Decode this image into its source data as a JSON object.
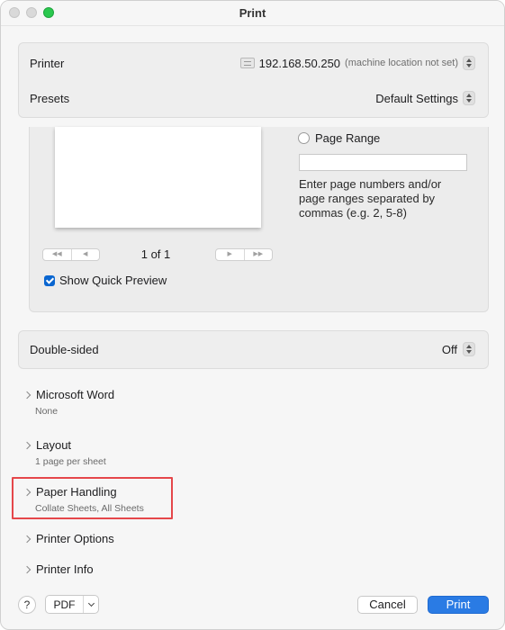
{
  "window": {
    "title": "Print"
  },
  "printer": {
    "label": "Printer",
    "icon": "printer-icon",
    "address": "192.168.50.250",
    "location": "(machine location not set)"
  },
  "presets": {
    "label": "Presets",
    "value": "Default Settings"
  },
  "preview": {
    "page_count": "1 of 1",
    "nav_first": "◀◀",
    "nav_prev": "◀",
    "nav_next": "▶",
    "nav_last": "▶▶",
    "show_quick_preview_label": "Show Quick Preview",
    "show_quick_preview_checked": true
  },
  "page_range": {
    "label": "Page Range",
    "input_value": "",
    "help": "Enter page numbers and/or page ranges separated by commas (e.g. 2, 5-8)"
  },
  "double_sided": {
    "label": "Double-sided",
    "value": "Off"
  },
  "sections": [
    {
      "title": "Microsoft Word",
      "subtitle": "None"
    },
    {
      "title": "Layout",
      "subtitle": "1 page per sheet"
    },
    {
      "title": "Paper Handling",
      "subtitle": "Collate Sheets, All Sheets"
    },
    {
      "title": "Printer Options",
      "subtitle": ""
    },
    {
      "title": "Printer Info",
      "subtitle": ""
    }
  ],
  "footer": {
    "help": "?",
    "pdf": "PDF",
    "cancel": "Cancel",
    "print": "Print"
  },
  "colors": {
    "accent": "#2a7be4",
    "highlight": "#e5474a",
    "checkbox": "#0a66d0"
  }
}
